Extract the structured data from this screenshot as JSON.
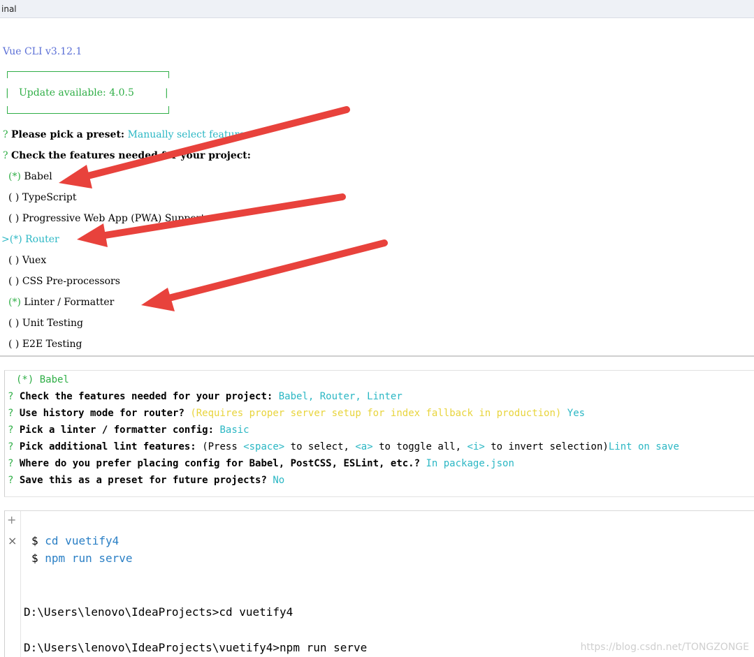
{
  "window": {
    "title": "inal"
  },
  "cli": {
    "version": "Vue CLI v3.12.1",
    "update_notice": "Update available: 4.0.5",
    "preset_q_mark": "?",
    "preset_question": "Please pick a preset:",
    "preset_answer": "Manually select features",
    "features_q_mark": "?",
    "features_question": "Check the features needed for your project:",
    "features": [
      {
        "mark": "(*)",
        "label": "Babel",
        "selected": true
      },
      {
        "mark": "( )",
        "label": "TypeScript",
        "selected": false
      },
      {
        "mark": "( )",
        "label": "Progressive Web App (PWA) Support",
        "selected": false
      },
      {
        "mark": "(*)",
        "label": "Router",
        "selected": true,
        "cursor": ">"
      },
      {
        "mark": "( )",
        "label": "Vuex",
        "selected": false
      },
      {
        "mark": "( )",
        "label": "CSS Pre-processors",
        "selected": false
      },
      {
        "mark": "(*)",
        "label": "Linter / Formatter",
        "selected": true
      },
      {
        "mark": "( )",
        "label": "Unit Testing",
        "selected": false
      },
      {
        "mark": "( )",
        "label": "E2E Testing",
        "selected": false
      }
    ]
  },
  "summary": {
    "top_item": "(*) Babel",
    "q": "?",
    "lines": [
      {
        "question": "Check the features needed for your project:",
        "answer": "Babel, Router, Linter"
      },
      {
        "question": "Use history mode for router?",
        "hint": "(Requires proper server setup for index fallback in production)",
        "answer": "Yes"
      },
      {
        "question": "Pick a linter / formatter config:",
        "answer": "Basic"
      },
      {
        "question": "Pick additional lint features:",
        "hint_pre": "(Press ",
        "k1": "<space>",
        "t1": " to select, ",
        "k2": "<a>",
        "t2": " to toggle all, ",
        "k3": "<i>",
        "t3": " to invert selection)",
        "answer": "Lint on save"
      },
      {
        "question": "Where do you prefer placing config for Babel, PostCSS, ESLint, etc.?",
        "answer": "In package.json"
      },
      {
        "question": "Save this as a preset for future projects?",
        "answer": "No"
      }
    ]
  },
  "terminal": {
    "plus": "+",
    "close": "×",
    "cmd1_prompt": "$",
    "cmd1": "cd vuetify4",
    "cmd2_prompt": "$",
    "cmd2": "npm run serve",
    "out1": "D:\\Users\\lenovo\\IdeaProjects>cd vuetify4",
    "out2": "D:\\Users\\lenovo\\IdeaProjects\\vuetify4>npm run serve",
    "watermark": "https://blog.csdn.net/TONGZONGE"
  },
  "colors": {
    "arrow": "#e8423c",
    "cyan": "#2bb7c4",
    "green": "#2fae46",
    "yellow": "#e8d43c"
  }
}
